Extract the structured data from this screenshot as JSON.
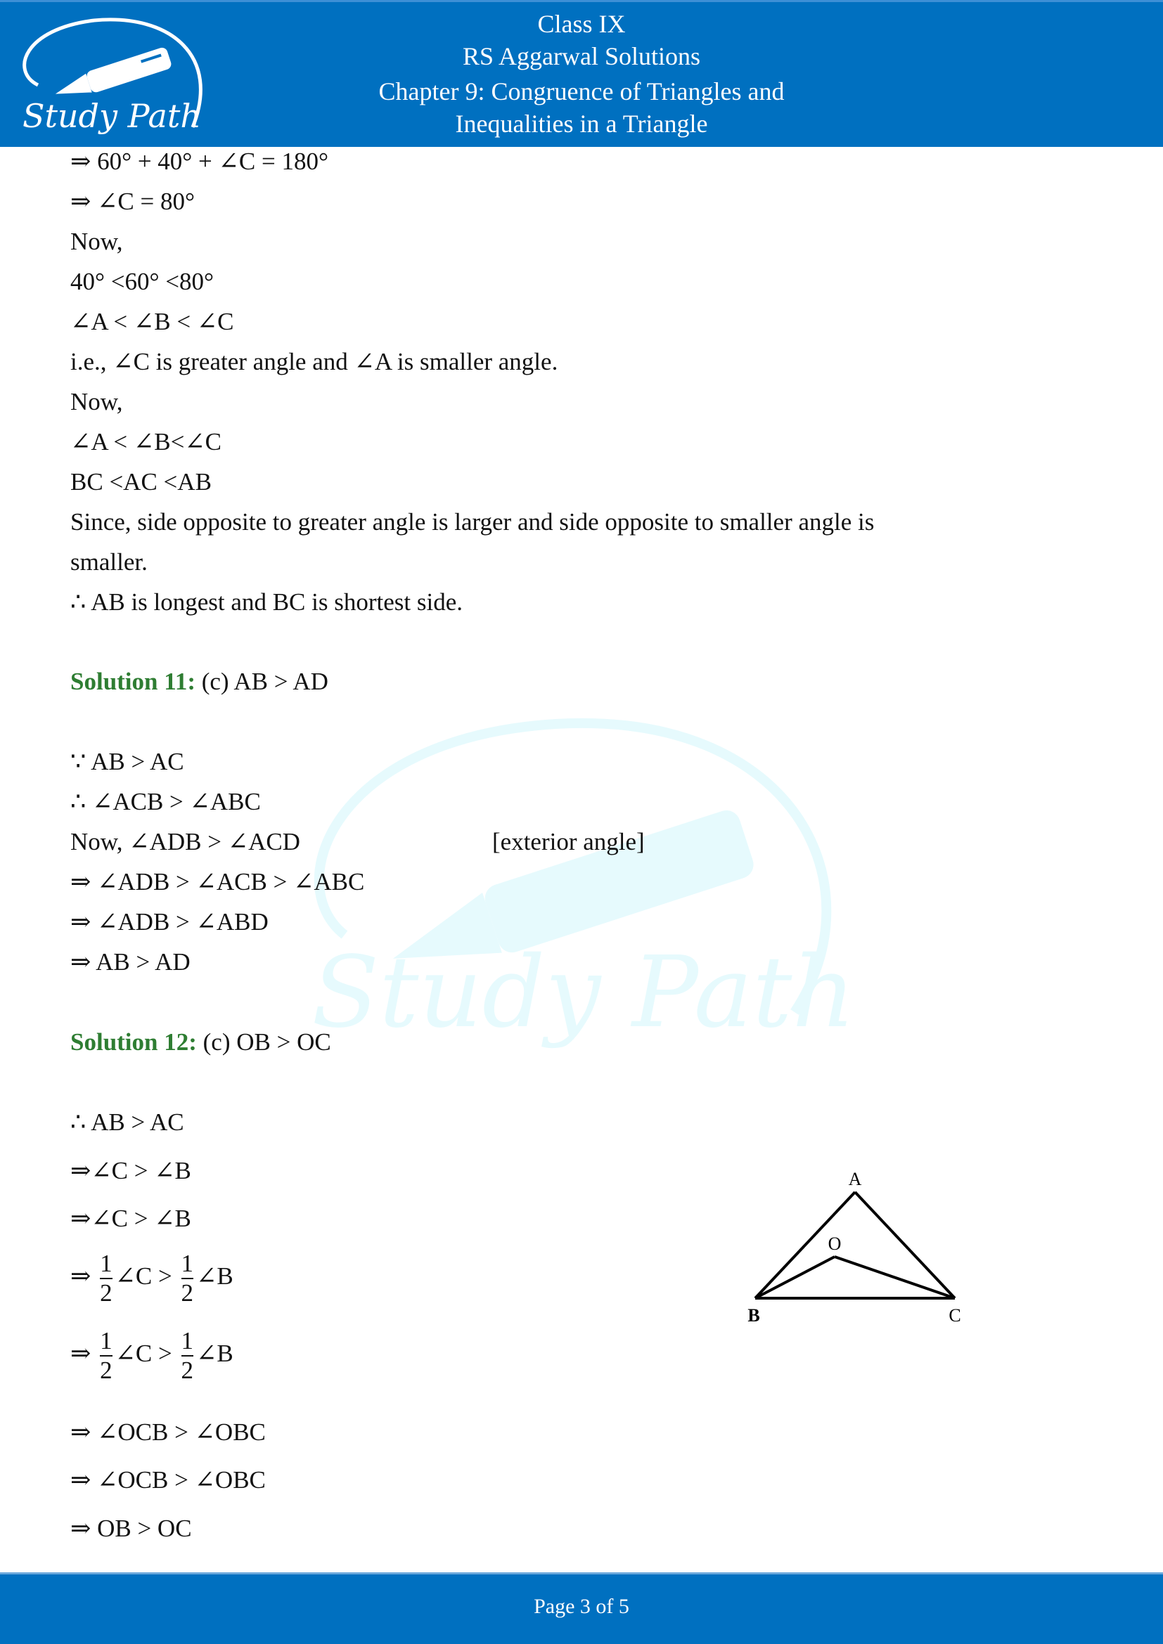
{
  "header": {
    "logo_text": "Study Path",
    "lines": [
      "Class IX",
      "RS Aggarwal Solutions",
      "Chapter 9: Congruence of Triangles and",
      "Inequalities in a Triangle"
    ]
  },
  "watermark": {
    "text": "Study Path"
  },
  "continuation": {
    "lines": [
      "⇒ 60° + 40° + ∠C = 180°",
      "⇒ ∠C = 80°",
      "Now,",
      "40° <60° <80°",
      "∠A < ∠B < ∠C",
      "i.e., ∠C is greater angle and ∠A is smaller angle.",
      "Now,",
      "∠A < ∠B<∠C",
      "BC <AC <AB",
      "Since, side opposite to greater angle is larger and side opposite to smaller angle is",
      "smaller.",
      "∴ AB is longest and BC is shortest side."
    ]
  },
  "solution11": {
    "label": "Solution 11:",
    "answer": " (c) AB > AD",
    "lines": [
      "∵ AB > AC",
      "∴ ∠ACB > ∠ABC",
      " Now, ∠ADB > ∠ACD",
      "⇒ ∠ADB > ∠ACB > ∠ABC",
      "⇒ ∠ADB > ∠ABD",
      "⇒ AB > AD"
    ],
    "note": "[exterior angle]"
  },
  "solution12": {
    "label": "Solution 12:",
    "answer": " (c) OB > OC",
    "lines": [
      "∴ AB > AC",
      "⇒∠C > ∠B",
      "⇒∠C > ∠B"
    ],
    "fraction_lines": [
      {
        "prefix": "⇒ ",
        "num1": "1",
        "den1": "2",
        "mid": "∠C > ",
        "num2": "1",
        "den2": "2",
        "suffix": "∠B"
      },
      {
        "prefix": "⇒ ",
        "num1": "1",
        "den1": "2",
        "mid": "∠C > ",
        "num2": "1",
        "den2": "2",
        "suffix": "∠B"
      }
    ],
    "final_lines": [
      "⇒ ∠OCB > ∠OBC",
      "⇒ ∠OCB > ∠OBC",
      "⇒ OB > OC"
    ],
    "figure": {
      "labels": {
        "A": "A",
        "O": "O",
        "B": "B",
        "C": "C"
      }
    }
  },
  "footer": {
    "text": "Page 3 of 5"
  },
  "colors": {
    "brand_blue": "#0070c0",
    "solution_green": "#2e7d32",
    "watermark": "#e6fafd"
  }
}
